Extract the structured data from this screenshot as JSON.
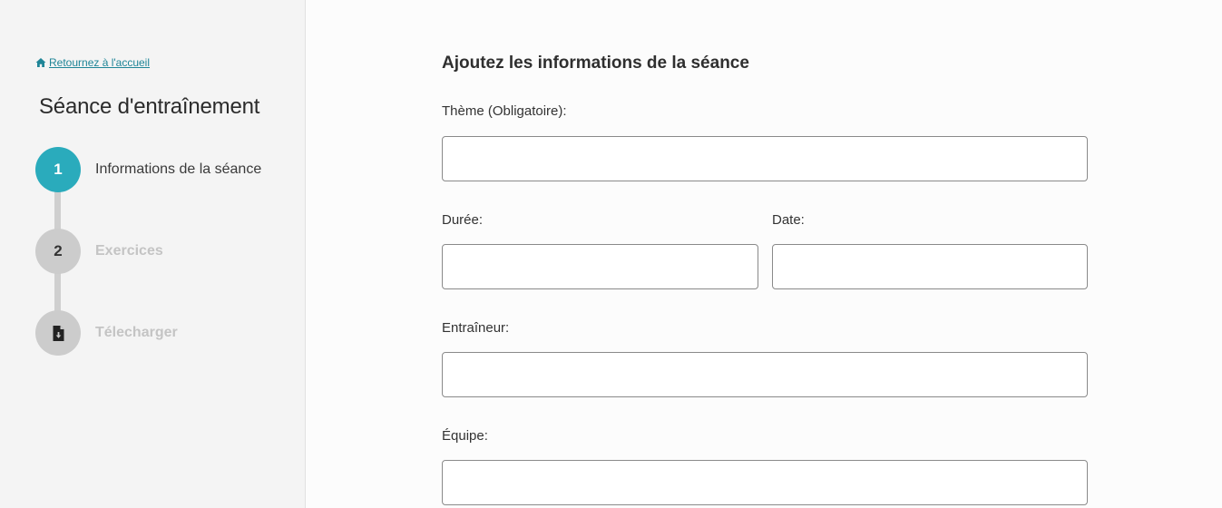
{
  "sidebar": {
    "home_link": "Retournez à l'accueil",
    "title": "Séance d'entraînement",
    "steps": [
      {
        "number": "1",
        "label": "Informations de la séance",
        "state": "active"
      },
      {
        "number": "2",
        "label": "Exercices",
        "state": "inactive"
      },
      {
        "icon": "file-download-icon",
        "label": "Télecharger",
        "state": "inactive"
      }
    ]
  },
  "form": {
    "title": "Ajoutez les informations de la séance",
    "theme": {
      "label": "Thème (Obligatoire):",
      "value": ""
    },
    "duree": {
      "label": "Durée:",
      "value": ""
    },
    "date": {
      "label": "Date:",
      "value": ""
    },
    "entraineur": {
      "label": "Entraîneur:",
      "value": ""
    },
    "equipe": {
      "label": "Équipe:",
      "value": ""
    }
  },
  "colors": {
    "accent": "#2aabbc",
    "link": "#1f8597",
    "inactive_circle": "#cccccc",
    "inactive_text": "#c4c4c4",
    "sidebar_bg": "#f4f4f4"
  }
}
